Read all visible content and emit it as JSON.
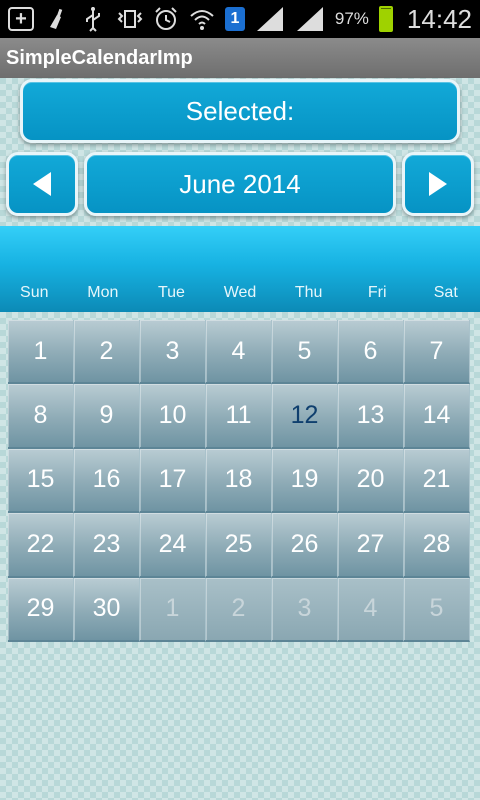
{
  "status_bar": {
    "icons": [
      "plus-box-icon",
      "cleaning-icon",
      "usb-icon",
      "vibrate-icon",
      "alarm-icon",
      "wifi-icon",
      "sim-icon",
      "signal-icon",
      "signal-icon",
      "battery-icon"
    ],
    "sim_label": "1",
    "battery_percent": "97%",
    "time": "14:42"
  },
  "app": {
    "title": "SimpleCalendarImp"
  },
  "selected": {
    "label": "Selected:"
  },
  "month_nav": {
    "month_label": "June 2014"
  },
  "weekdays": [
    "Sun",
    "Mon",
    "Tue",
    "Wed",
    "Thu",
    "Fri",
    "Sat"
  ],
  "days": [
    [
      "1",
      "2",
      "3",
      "4",
      "5",
      "6",
      "7"
    ],
    [
      "8",
      "9",
      "10",
      "11",
      "12",
      "13",
      "14"
    ],
    [
      "15",
      "16",
      "17",
      "18",
      "19",
      "20",
      "21"
    ],
    [
      "22",
      "23",
      "24",
      "25",
      "26",
      "27",
      "28"
    ],
    [
      "29",
      "30",
      "1",
      "2",
      "3",
      "4",
      "5"
    ]
  ],
  "next_month_days_count": 5,
  "today": "12",
  "colors": {
    "accent": "#0693c4",
    "header_gradient_top": "#34cff8",
    "today_text": "#0f3f6e"
  }
}
